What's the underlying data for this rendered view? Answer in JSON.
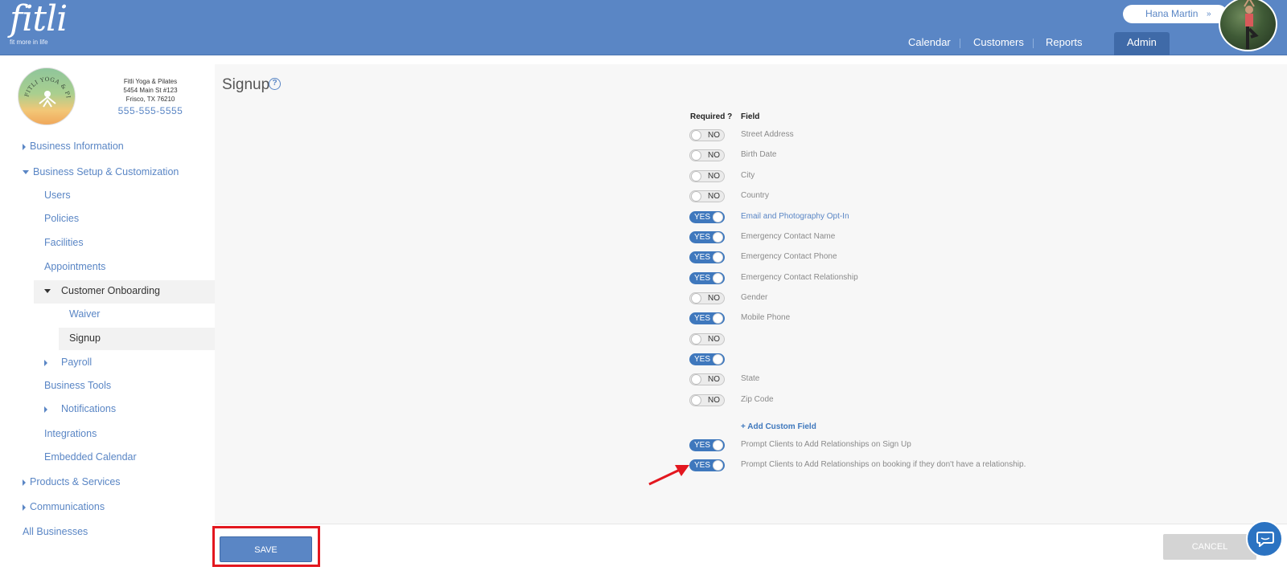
{
  "header": {
    "logo_text": "fitli",
    "logo_tagline": "fit more in life",
    "user_name": "Hana Martin",
    "nav": [
      "Calendar",
      "Customers",
      "Reports",
      "Admin"
    ]
  },
  "business": {
    "name": "Fitli Yoga & Pilates",
    "address1": "5454 Main St #123",
    "address2": "Frisco, TX 76210",
    "phone": "555-555-5555",
    "logo_text": "FITLI YOGA & PILATES"
  },
  "sidebar": {
    "items": [
      "Business Information",
      "Business Setup & Customization",
      "Users",
      "Policies",
      "Facilities",
      "Appointments",
      "Customer Onboarding",
      "Waiver",
      "Signup",
      "Payroll",
      "Business Tools",
      "Notifications",
      "Integrations",
      "Embedded Calendar",
      "Products & Services",
      "Communications",
      "All Businesses"
    ]
  },
  "main": {
    "title": "Signup",
    "col_required": "Required ?",
    "col_field": "Field",
    "fields": [
      {
        "toggle": "NO",
        "label": "Street Address"
      },
      {
        "toggle": "NO",
        "label": "Birth Date"
      },
      {
        "toggle": "NO",
        "label": "City"
      },
      {
        "toggle": "NO",
        "label": "Country"
      },
      {
        "toggle": "YES",
        "label": "Email and Photography Opt-In"
      },
      {
        "toggle": "YES",
        "label": "Emergency Contact Name"
      },
      {
        "toggle": "YES",
        "label": "Emergency Contact Phone"
      },
      {
        "toggle": "YES",
        "label": "Emergency Contact Relationship"
      },
      {
        "toggle": "NO",
        "label": "Gender"
      },
      {
        "toggle": "YES",
        "label": "Mobile Phone"
      },
      {
        "toggle": "NO",
        "label": ""
      },
      {
        "toggle": "YES",
        "label": ""
      },
      {
        "toggle": "NO",
        "label": "State"
      },
      {
        "toggle": "NO",
        "label": "Zip Code"
      }
    ],
    "add_custom_field": "+ Add Custom Field",
    "prompts": [
      {
        "toggle": "YES",
        "label": "Prompt Clients to Add Relationships on Sign Up"
      },
      {
        "toggle": "YES",
        "label": "Prompt Clients to Add Relationships on booking if they don't have a relationship."
      }
    ]
  },
  "footer": {
    "save_label": "SAVE",
    "cancel_label": "CANCEL"
  },
  "colors": {
    "brand_blue": "#5a86c5",
    "toggle_on": "#3f78bd",
    "highlight_red": "#e3171f"
  }
}
